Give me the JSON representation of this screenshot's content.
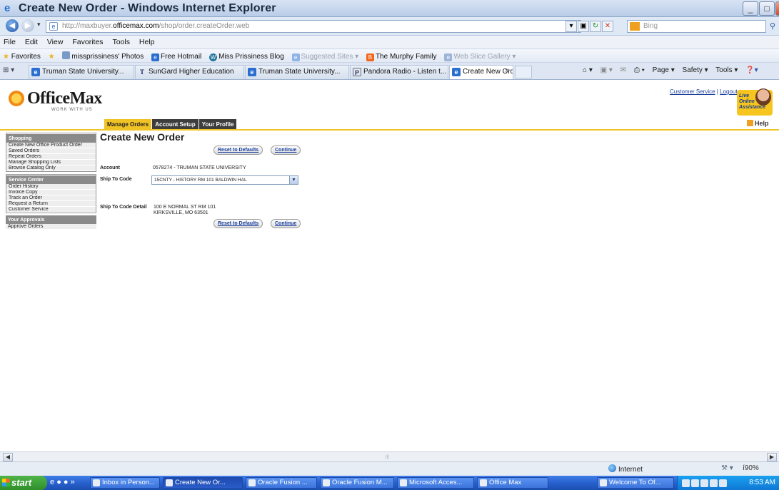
{
  "window": {
    "title": "Create New Order - Windows Internet Explorer",
    "minimize": "_",
    "maximize": "□",
    "close": "X"
  },
  "address_bar": {
    "url_prefix": "http://maxbuyer.",
    "url_domain": "officemax.com",
    "url_path": "/shop/order.createOrder.web",
    "search_placeholder": "Bing"
  },
  "menu": [
    "File",
    "Edit",
    "View",
    "Favorites",
    "Tools",
    "Help"
  ],
  "favorites_bar": {
    "label": "Favorites",
    "items": [
      {
        "label": "missprissiness' Photos",
        "dim": false
      },
      {
        "label": "Free Hotmail",
        "dim": false
      },
      {
        "label": "Miss Prissiness Blog",
        "dim": false
      },
      {
        "label": "Suggested Sites ▾",
        "dim": true
      },
      {
        "label": "The Murphy Family",
        "dim": false
      },
      {
        "label": "Web Slice Gallery ▾",
        "dim": true
      }
    ]
  },
  "tabs": [
    {
      "label": "Truman State University..."
    },
    {
      "label": "SunGard Higher Education"
    },
    {
      "label": "Truman State University..."
    },
    {
      "label": "Pandora Radio - Listen t..."
    },
    {
      "label": "Create New Order"
    }
  ],
  "command_bar": [
    "Page ▾",
    "Safety ▾",
    "Tools ▾"
  ],
  "site": {
    "logo_word": "OfficeMax",
    "logo_tag": "WORK WITH US",
    "customer_service": "Customer Service",
    "logout": "Logout",
    "live_help": [
      "Live",
      "Online",
      "Assistance"
    ],
    "nav_tabs": [
      "Manage Orders",
      "Account Setup",
      "Your Profile"
    ],
    "help": "Help"
  },
  "sidebar": {
    "groups": [
      {
        "heading": "Shopping",
        "items": [
          "Create New Office Product Order",
          "Saved Orders",
          "Repeat Orders",
          "Manage Shopping Lists",
          "Browse Catalog Only"
        ]
      },
      {
        "heading": "Service Center",
        "items": [
          "Order History",
          "Invoice Copy",
          "Track an Order",
          "Request a Return",
          "Customer Service"
        ]
      },
      {
        "heading": "Your Approvals",
        "items": [
          "Approve Orders"
        ]
      }
    ]
  },
  "form": {
    "title": "Create New Order",
    "reset_label": "Reset to Defaults",
    "continue_label": "Continue",
    "account_label": "Account",
    "account_value": "0578274 - TRUMAN STATE UNIVERSITY",
    "ship_to_label": "Ship To Code",
    "ship_to_value": "15CNTY - HISTORY RM 101 BALDWIN HAL",
    "detail_label": "Ship To Code Detail",
    "detail_line1": "100 E NORMAL ST RM 101",
    "detail_line2": "KIRKSVILLE,  MO  63501"
  },
  "status_bar": {
    "zone": "Internet",
    "zoom": "í90%"
  },
  "taskbar": {
    "start": "start",
    "tasks": [
      "Inbox in Person...",
      "Create New Or...",
      "Oracle Fusion ...",
      "Oracle Fusion M...",
      "Microsoft Acces...",
      "Office Max",
      "Welcome To Of..."
    ],
    "clock": "8:53 AM"
  }
}
